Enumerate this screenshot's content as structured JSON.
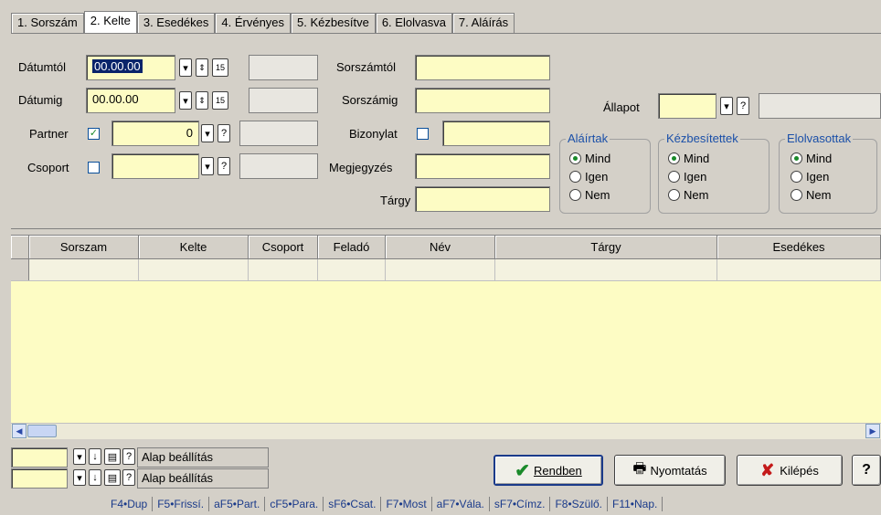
{
  "tabs": [
    "1. Sorszám",
    "2. Kelte",
    "3. Esedékes",
    "4. Érvényes",
    "5. Kézbesítve",
    "6. Elolvasva",
    "7. Aláírás"
  ],
  "active_tab": 1,
  "filters": {
    "datumtol_label": "Dátumtól",
    "datumtol_value": "00.00.00",
    "datumig_label": "Dátumig",
    "datumig_value": "00.00.00",
    "partner_label": "Partner",
    "partner_value": "0",
    "csoport_label": "Csoport",
    "sorszamtol_label": "Sorszámtól",
    "sorszamig_label": "Sorszámig",
    "bizonylat_label": "Bizonylat",
    "megjegyzes_label": "Megjegyzés",
    "targy_label": "Tárgy",
    "allapot_label": "Állapot",
    "calendar_icon_text": "15"
  },
  "groups": {
    "alairtak": {
      "title": "Aláírtak",
      "options": [
        "Mind",
        "Igen",
        "Nem"
      ]
    },
    "kezbesitettek": {
      "title": "Kézbesítettek",
      "options": [
        "Mind",
        "Igen",
        "Nem"
      ]
    },
    "elolvasottak": {
      "title": "Elolvasottak",
      "options": [
        "Mind",
        "Igen",
        "Nem"
      ]
    }
  },
  "grid": {
    "columns": [
      "Sorszam",
      "Kelte",
      "Csoport",
      "Feladó",
      "Név",
      "Tárgy",
      "Esedékes"
    ]
  },
  "bottom": {
    "preset1": "Alap beállítás",
    "preset2": "Alap beállítás",
    "ok_label": "Rendben",
    "print_label": "Nyomtatás",
    "exit_label": "Kilépés",
    "help_label": "?"
  },
  "statusbar": [
    "F4•Dup",
    "F5•Frissí.",
    "aF5•Part.",
    "cF5•Para.",
    "sF6•Csat.",
    "F7•Most",
    "aF7•Vála.",
    "sF7•Címz.",
    "F8•Szülő.",
    "F11•Nap."
  ],
  "colors": {
    "input_bg": "#fdfcc4",
    "group_title": "#1a4fa8",
    "panel_bg": "#d4d0c8"
  }
}
